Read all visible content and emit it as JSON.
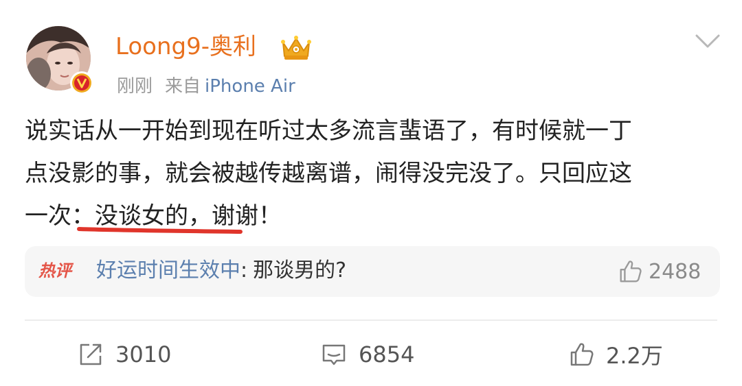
{
  "post": {
    "author": {
      "name": "Loong9-奥利",
      "avatar_icon": "avatar-photo",
      "verified_icon": "verified-badge-icon",
      "crown_icon": "crown-icon"
    },
    "meta": {
      "time": "刚刚",
      "source_prefix": "来自",
      "device": "iPhone Air"
    },
    "content_lines": [
      "说实话从一开始到现在听过太多流言蜚语了，有时候就一丁",
      "点没影的事，就会被越传越离谱，闹得没完没了。只回应这",
      "一次：没谈女的，谢谢！"
    ],
    "hot_comment": {
      "badge": "热评",
      "user": "好运时间生效中",
      "separator": ":",
      "text": "那谈男的?",
      "likes": "2488"
    },
    "actions": {
      "share_count": "3010",
      "comment_count": "6854",
      "like_count": "2.2万"
    }
  },
  "colors": {
    "username": "#e8701e",
    "link_blue": "#5b7fae",
    "hot_red": "#e45548",
    "underline_red": "#e0352b",
    "verified_red": "#d8232a",
    "crown_gold": "#f0a91f"
  }
}
